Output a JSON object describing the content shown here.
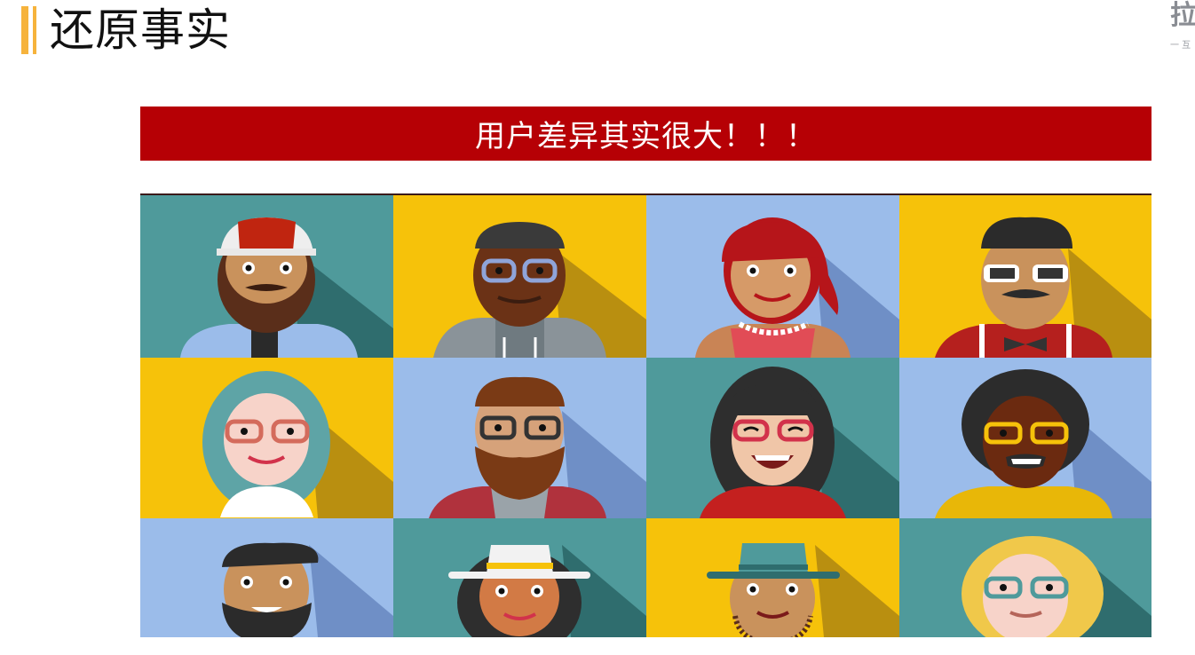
{
  "header": {
    "title": "还原事实",
    "logo_text": "拉",
    "logo_sub": "一 互"
  },
  "banner": {
    "text": "用户差异其实很大！！！"
  },
  "colors": {
    "accent": "#f6b33c",
    "banner_bg": "#b60005",
    "teal": "#4f9a9b",
    "yellow": "#f6c20a",
    "blue": "#9bbcea"
  },
  "avatars": [
    {
      "name": "bearded-man-cap-avatar"
    },
    {
      "name": "dark-man-glasses-hoodie-avatar"
    },
    {
      "name": "red-hair-woman-necklace-avatar"
    },
    {
      "name": "man-sunglasses-bowtie-avatar"
    },
    {
      "name": "teal-hair-woman-glasses-avatar"
    },
    {
      "name": "bearded-man-glasses-plaid-avatar"
    },
    {
      "name": "dark-hair-woman-glasses-avatar"
    },
    {
      "name": "afro-man-yellow-glasses-avatar"
    },
    {
      "name": "man-beard-black-hair-avatar"
    },
    {
      "name": "woman-white-hat-avatar"
    },
    {
      "name": "man-teal-hat-avatar"
    },
    {
      "name": "blonde-person-glasses-avatar"
    }
  ]
}
